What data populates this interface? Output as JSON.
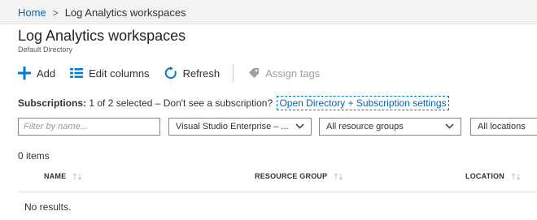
{
  "breadcrumb": {
    "home": "Home",
    "separator": ">",
    "current": "Log Analytics workspaces"
  },
  "page": {
    "title": "Log Analytics workspaces",
    "subtitle": "Default Directory"
  },
  "toolbar": {
    "add": {
      "label": "Add",
      "icon": "plus-icon"
    },
    "edit_columns": {
      "label": "Edit columns",
      "icon": "columns-icon"
    },
    "refresh": {
      "label": "Refresh",
      "icon": "refresh-icon"
    },
    "assign_tags": {
      "label": "Assign tags",
      "icon": "tag-icon",
      "disabled": true
    }
  },
  "subscriptions": {
    "label": "Subscriptions:",
    "text": "1 of 2 selected – Don't see a subscription?",
    "link": "Open Directory + Subscription settings"
  },
  "filters": {
    "name_placeholder": "Filter by name...",
    "subscription": "Visual Studio Enterprise – ...",
    "resource_group": "All resource groups",
    "location": "All locations"
  },
  "results": {
    "count": "0 items",
    "empty": "No results."
  },
  "table": {
    "columns": [
      "NAME",
      "RESOURCE GROUP",
      "LOCATION"
    ]
  },
  "colors": {
    "accent": "#0078d4",
    "link": "#0064b4",
    "text": "#323130",
    "breadcrumb_bg": "#f3f3f3"
  }
}
